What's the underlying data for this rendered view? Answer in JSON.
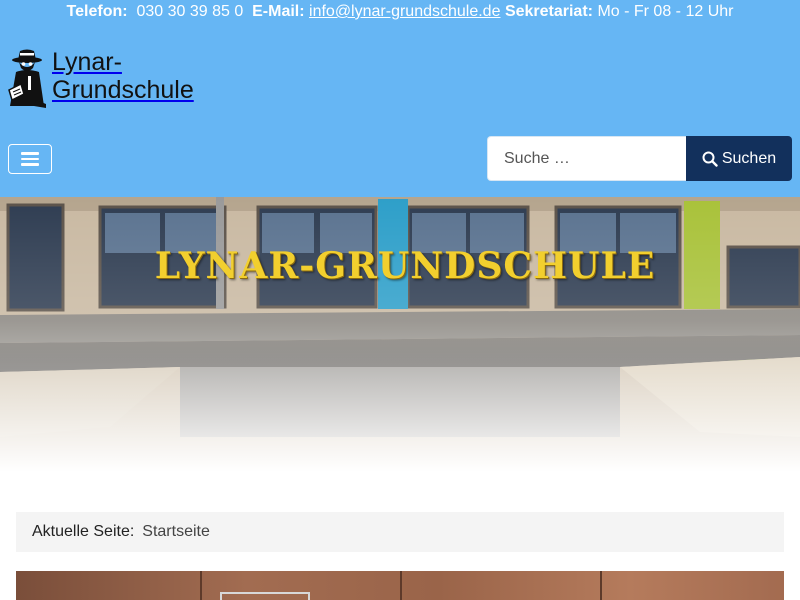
{
  "topbar": {
    "phone_label": "Telefon:",
    "phone_value": "030 30 39 85 0",
    "email_label": "E-Mail:",
    "email_value": "info@lynar-grundschule.de",
    "office_label": "Sekretariat:",
    "office_hours": "Mo - Fr 08 - 12 Uhr"
  },
  "logo": {
    "line1": "Lynar-",
    "line2": "Grundschule",
    "icon": "detective-mascot-icon"
  },
  "nav": {
    "toggle_icon": "hamburger-icon"
  },
  "search": {
    "placeholder": "Suche …",
    "button_label": "Suchen",
    "icon": "search-icon"
  },
  "hero": {
    "sign_text": "LYNAR-GRUNDSCHULE"
  },
  "breadcrumb": {
    "label": "Aktuelle Seite:",
    "current": "Startseite"
  },
  "colors": {
    "header_bg": "#66b6f4",
    "search_button_bg": "#12305c",
    "breadcrumb_bg": "#f4f4f4"
  }
}
